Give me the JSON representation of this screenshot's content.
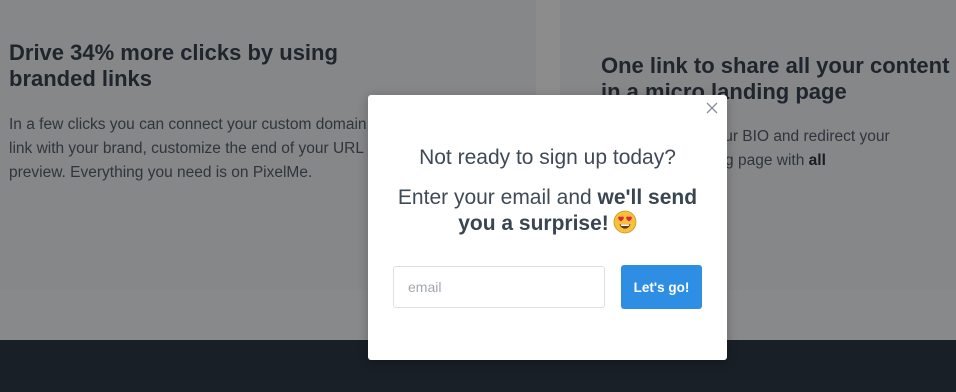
{
  "background": {
    "left_card": {
      "title": "Drive 34% more clicks by using branded links",
      "text_parts": [
        "In a few clicks you can connect your custom domain, create a shortened link with your brand, customize the end of your URL or edit the link preview. Everything you need is on PixelMe."
      ]
    },
    "right_card": {
      "title": "One link to share all your content in a micro landing page",
      "text_plain": "Add one link to your BIO and redirect your visitors to a landing page with ",
      "text_bold": "all"
    }
  },
  "modal": {
    "heading": "Not ready to sign up today?",
    "sub_plain": "Enter your email and ",
    "sub_bold": "we'll send you a surprise!",
    "emoji": "heart-eyes-emoji",
    "email_placeholder": "email",
    "email_value": "",
    "submit_label": "Let's go!",
    "accent_color": "#2d8ee4"
  }
}
